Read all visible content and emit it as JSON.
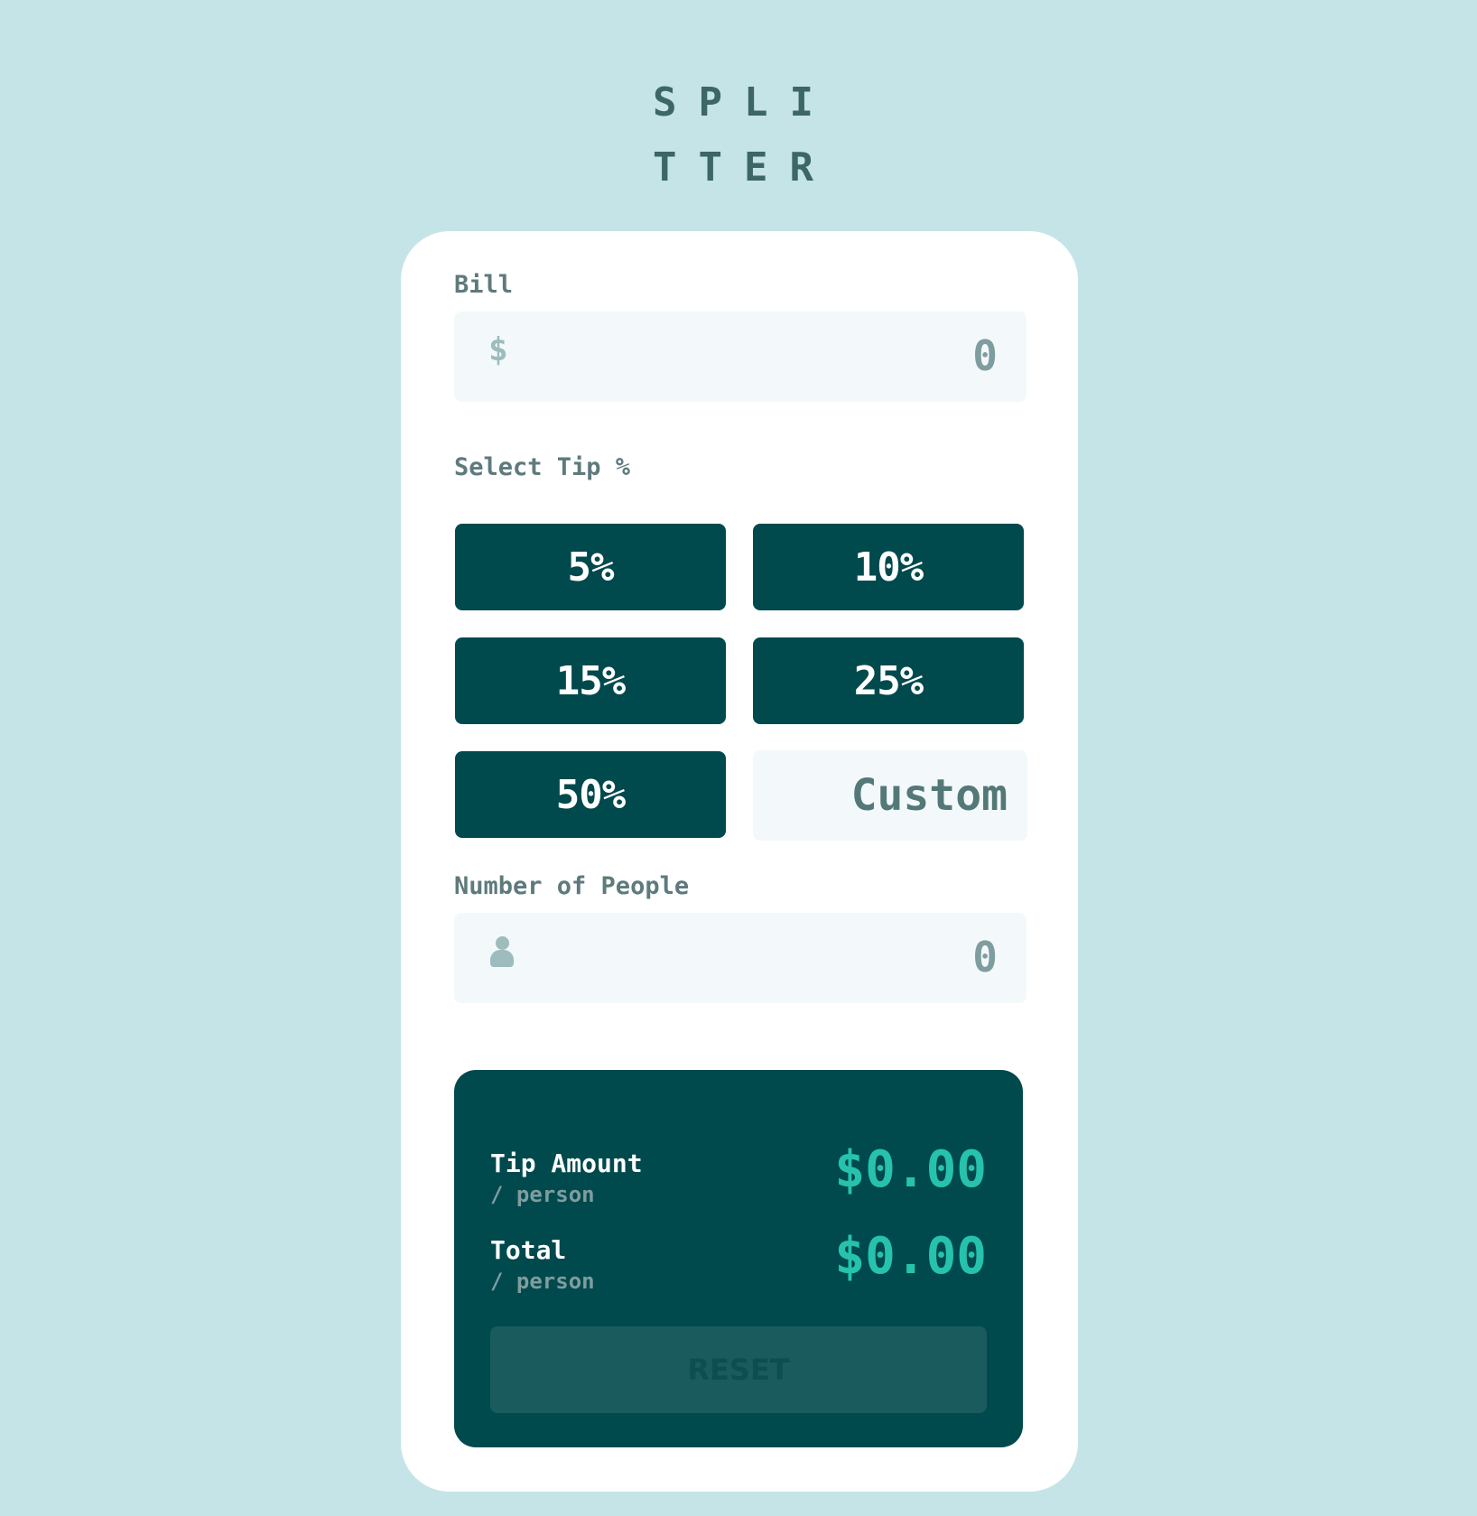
{
  "logo": {
    "line1": "SPLI",
    "line2": "TTER"
  },
  "bill": {
    "label": "Bill",
    "prefix": "$",
    "value": "0"
  },
  "tip": {
    "label": "Select Tip %",
    "options": [
      "5%",
      "10%",
      "15%",
      "25%",
      "50%"
    ],
    "custom_placeholder": "Custom"
  },
  "people": {
    "label": "Number of People",
    "value": "0",
    "icon": "person-icon"
  },
  "results": {
    "tip_amount": {
      "label": "Tip Amount",
      "sub": "/ person",
      "value": "$0.00"
    },
    "total": {
      "label": "Total",
      "sub": "/ person",
      "value": "$0.00"
    },
    "reset_label": "RESET"
  },
  "colors": {
    "background": "#c5e4e7",
    "card": "#ffffff",
    "dark_cyan": "#00494d",
    "accent_cyan": "#26c2ad",
    "input_bg": "#f3f9fa",
    "reset_disabled": "#1a5c5e"
  }
}
